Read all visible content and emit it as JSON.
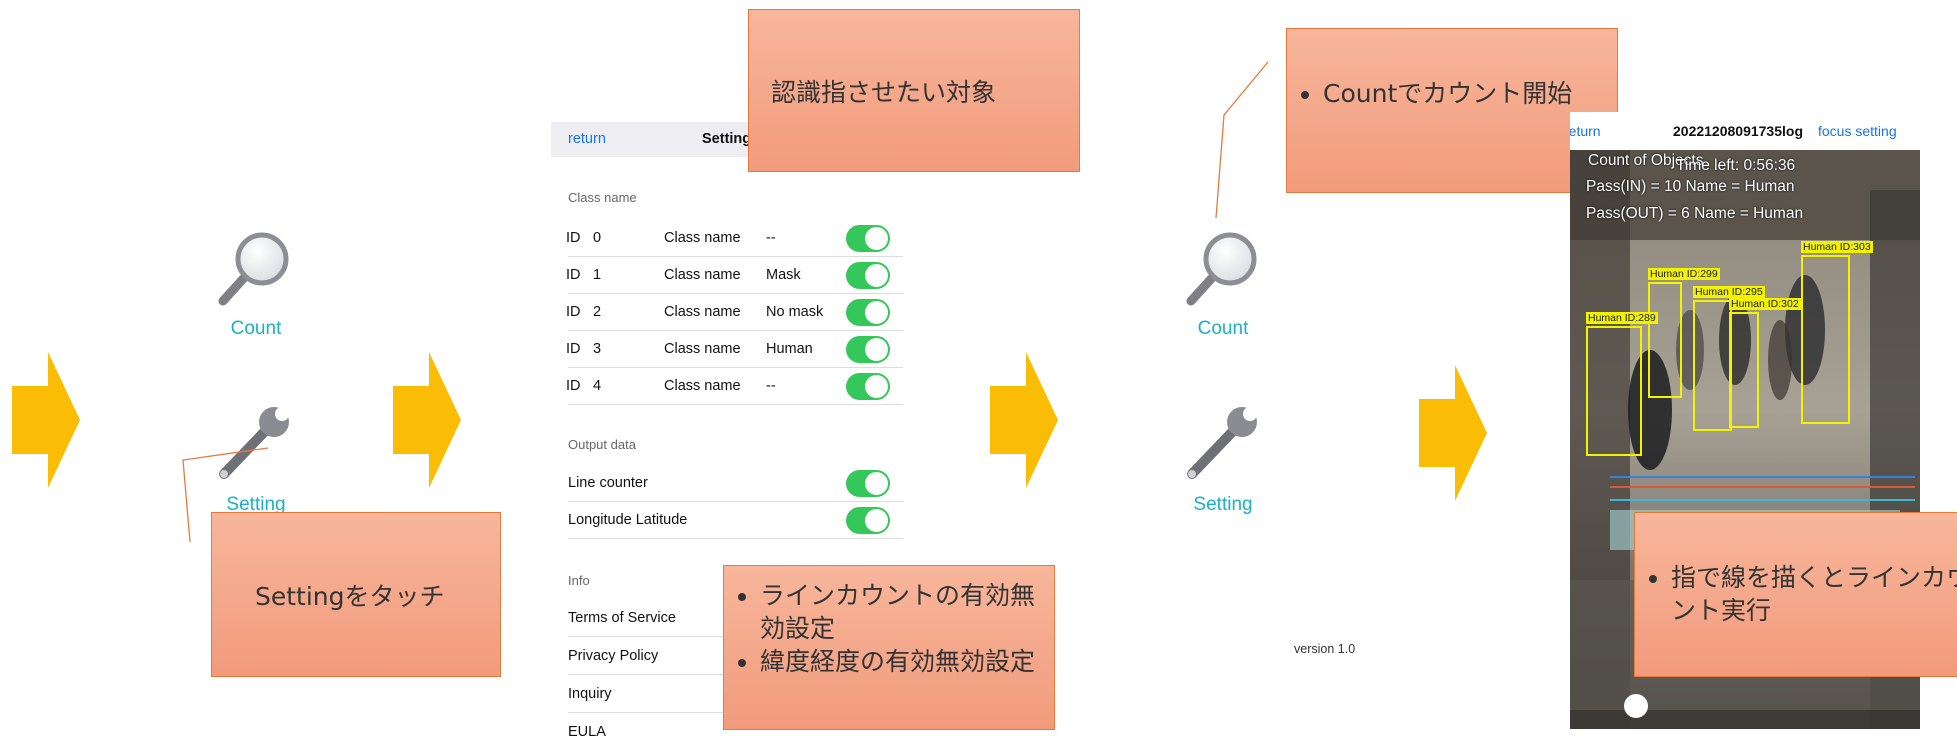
{
  "colors": {
    "arrow": "#fbbc05",
    "accent": "#1ab0c7",
    "link": "#1a73e8",
    "toggle": "#34c759",
    "callout_border": "#e67a3b",
    "box": "#f3f200"
  },
  "home": {
    "count_label": "Count",
    "setting_label": "Setting"
  },
  "callouts": {
    "touch_setting": "Settingをタッチ",
    "target": "認識指させたい対象",
    "toggles": [
      "ラインカウントの有効無効設定",
      "緯度経度の有効無効設定"
    ],
    "start_count": "Countでカウント開始",
    "draw_line": "指で線を描くとラインカウント実行"
  },
  "settings": {
    "return_label": "return",
    "title": "Settings",
    "class_section": "Class name",
    "id_label": "ID",
    "class_label": "Class name",
    "classes": [
      {
        "id": "0",
        "name": "--"
      },
      {
        "id": "1",
        "name": "Mask"
      },
      {
        "id": "2",
        "name": "No mask"
      },
      {
        "id": "3",
        "name": "Human"
      },
      {
        "id": "4",
        "name": "--"
      }
    ],
    "output_section": "Output data",
    "line_counter": "Line counter",
    "longitude_latitude": "Longitude Latitude",
    "info_section": "Info",
    "info_items": [
      "Terms of Service",
      "Privacy Policy",
      "Inquiry",
      "EULA"
    ]
  },
  "home2": {
    "count_label": "Count",
    "setting_label": "Setting",
    "version": "version 1.0"
  },
  "camera": {
    "return_label": "return",
    "log_name": "20221208091735log",
    "focus_label": "focus setting",
    "count_title": "Count of Objects",
    "time_left": "Time left: 0:56:36",
    "pass_in": "Pass(IN) = 10 Name = Human",
    "pass_out": "Pass(OUT) = 6 Name = Human",
    "detections": [
      "Human ID:303",
      "Human ID:299",
      "Human ID:295",
      "Human ID:302",
      "Human ID:289"
    ]
  }
}
